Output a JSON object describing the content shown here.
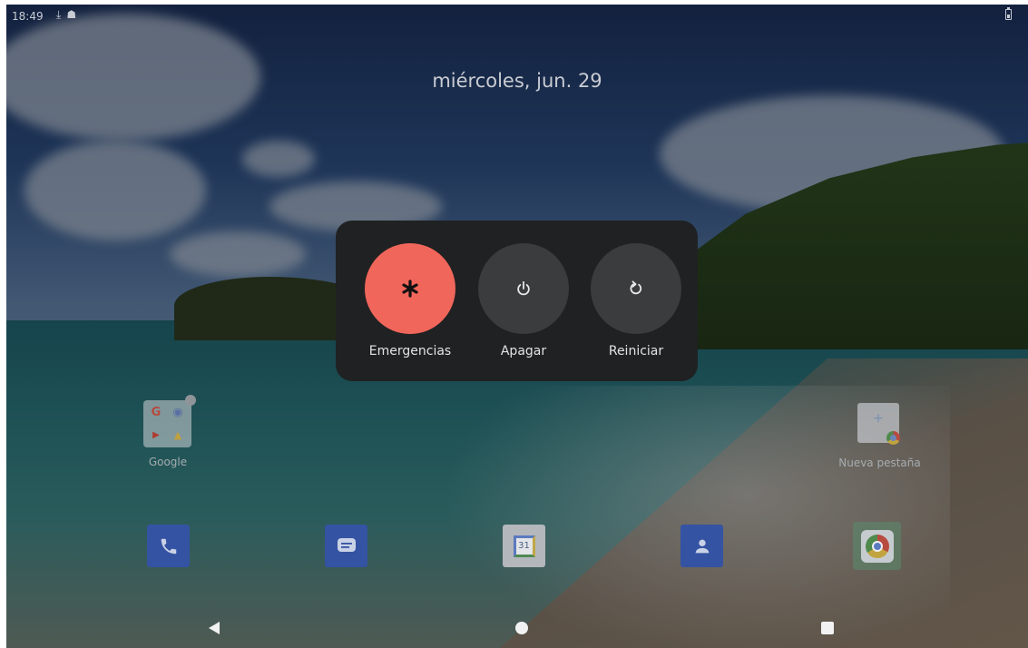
{
  "status_bar": {
    "time": "18:49",
    "notification_icons": [
      "download-icon",
      "incognito-icon"
    ],
    "battery_icon": "battery-icon"
  },
  "lockscreen": {
    "date": "miércoles, jun. 29"
  },
  "power_menu": {
    "options": [
      {
        "label": "Emergencias",
        "icon": "emergency-asterisk-icon",
        "color": "#f1665b"
      },
      {
        "label": "Apagar",
        "icon": "power-icon",
        "color": "#3b3c3e"
      },
      {
        "label": "Reiniciar",
        "icon": "restart-icon",
        "color": "#3b3c3e"
      }
    ]
  },
  "home": {
    "folder": {
      "label": "Google",
      "apps": [
        "G",
        "◉",
        "▶",
        "▲"
      ]
    },
    "shortcut": {
      "label": "Nueva pestaña",
      "plus": "+"
    },
    "dock": [
      {
        "icon": "phone-icon"
      },
      {
        "icon": "messages-icon"
      },
      {
        "icon": "calendar-icon",
        "text": "31"
      },
      {
        "icon": "contacts-icon"
      },
      {
        "icon": "chrome-icon"
      }
    ]
  },
  "nav": {
    "back": "back-icon",
    "home": "home-icon",
    "recents": "recents-icon"
  }
}
